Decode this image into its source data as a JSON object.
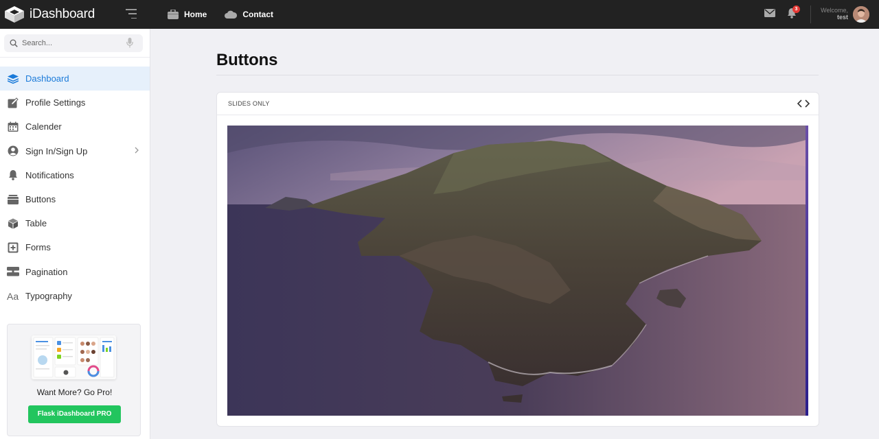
{
  "brand": {
    "name": "iDashboard"
  },
  "topnav": [
    {
      "label": "Home",
      "icon": "briefcase-icon"
    },
    {
      "label": "Contact",
      "icon": "cloud-icon"
    }
  ],
  "header": {
    "notification_count": "3",
    "welcome_label": "Welcome,",
    "username": "test"
  },
  "search": {
    "placeholder": "Search..."
  },
  "sidebar": {
    "items": [
      {
        "label": "Dashboard",
        "icon": "layers-icon",
        "active": true
      },
      {
        "label": "Profile Settings",
        "icon": "edit-icon"
      },
      {
        "label": "Calender",
        "icon": "calendar-icon"
      },
      {
        "label": "Sign In/Sign Up",
        "icon": "user-circle-icon",
        "has_submenu": true
      },
      {
        "label": "Notifications",
        "icon": "bell-icon"
      },
      {
        "label": "Buttons",
        "icon": "archive-icon"
      },
      {
        "label": "Table",
        "icon": "box-icon"
      },
      {
        "label": "Forms",
        "icon": "plus-square-icon"
      },
      {
        "label": "Pagination",
        "icon": "pagination-icon"
      },
      {
        "label": "Typography",
        "icon": "typography-icon"
      }
    ]
  },
  "promo": {
    "text": "Want More? Go Pro!",
    "button_label": "Flask iDashboard PRO"
  },
  "main": {
    "title": "Buttons",
    "card_title": "SLIDES ONLY"
  },
  "colors": {
    "topbar": "#222222",
    "accent": "#1a7ad9",
    "active_bg": "#e6f0fb",
    "pro_button": "#22c55e",
    "badge": "#e53935"
  }
}
